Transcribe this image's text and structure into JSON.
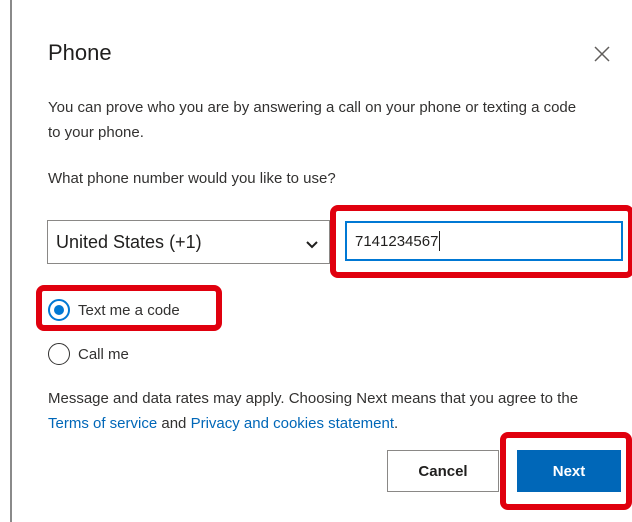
{
  "dialog": {
    "title": "Phone",
    "description": "You can prove who you are by answering a call on your phone or texting a code to your phone.",
    "question": "What phone number would you like to use?",
    "country_select": {
      "value": "United States (+1)"
    },
    "phone_input": {
      "value": "7141234567"
    },
    "options": [
      {
        "label": "Text me a code",
        "selected": true
      },
      {
        "label": "Call me",
        "selected": false
      }
    ],
    "footer": {
      "text_before": "Message and data rates may apply. Choosing Next means that you agree to the ",
      "terms_link": "Terms of service",
      "middle": " and ",
      "privacy_link": "Privacy and cookies statement",
      "end": "."
    },
    "buttons": {
      "cancel": "Cancel",
      "next": "Next"
    }
  },
  "colors": {
    "accent": "#0067b8",
    "highlight": "#e0000e",
    "focus": "#0078d4"
  },
  "icons": {
    "close": "close-icon",
    "dropdown": "chevron-down-icon"
  }
}
